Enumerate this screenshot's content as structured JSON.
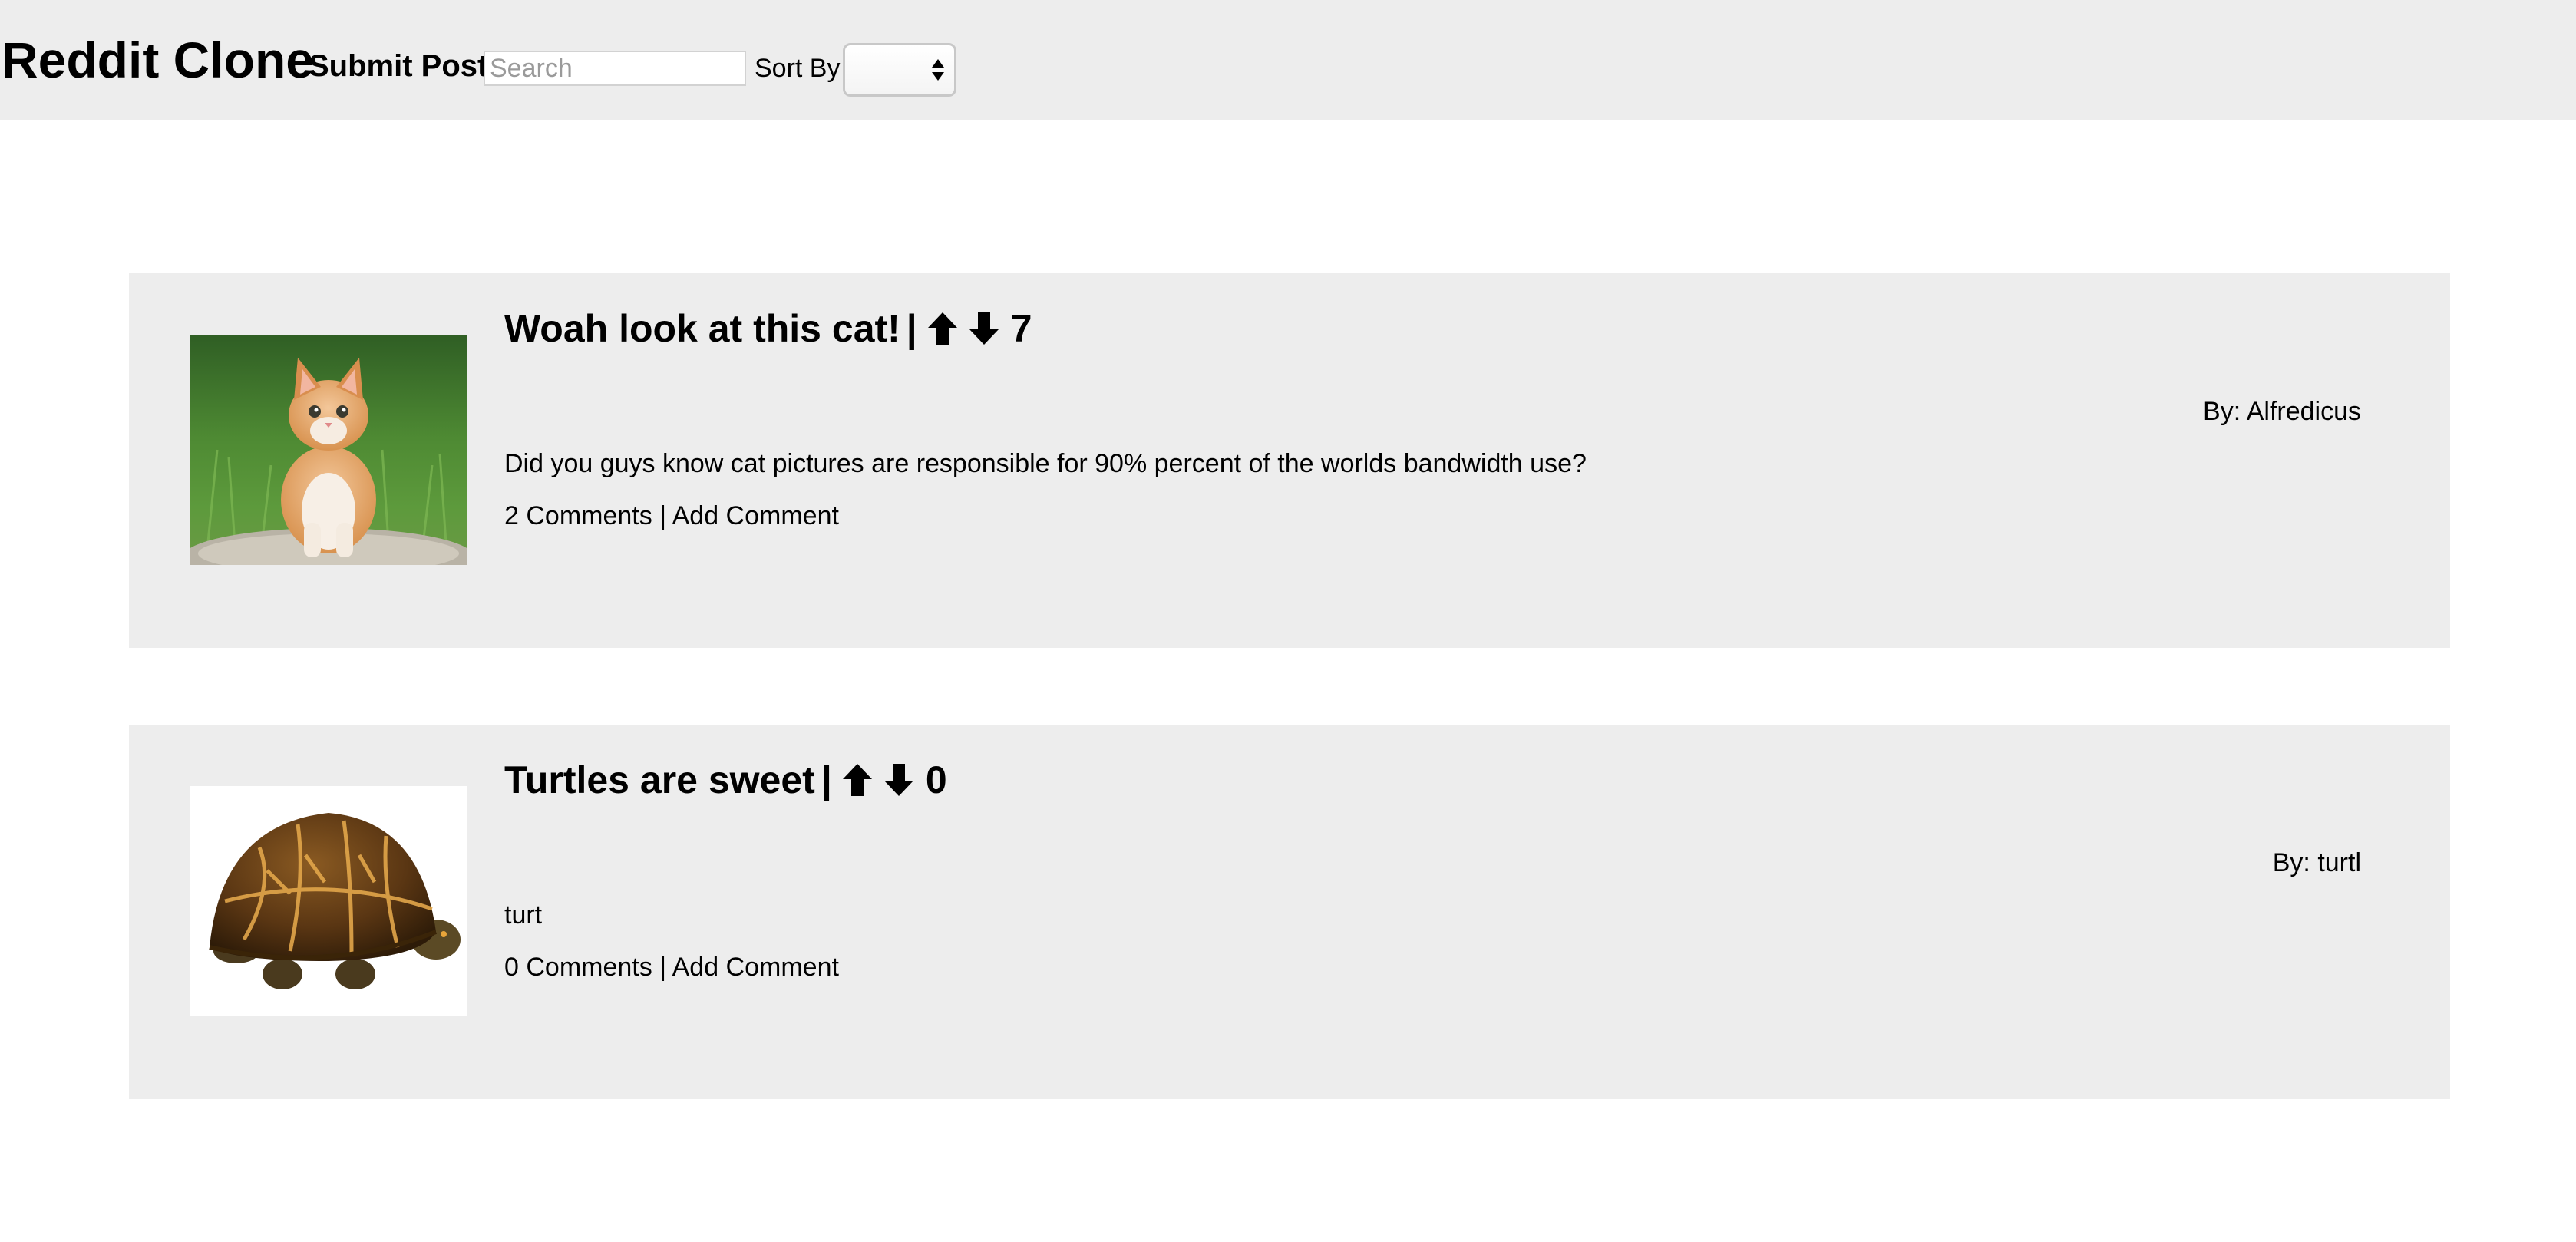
{
  "header": {
    "title": "Reddit Clone",
    "submit_label": "Submit Post",
    "search_placeholder": "Search",
    "sort_label": "Sort By",
    "sort_value": ""
  },
  "posts": [
    {
      "title": "Woah look at this cat!",
      "separator": "|",
      "score": "7",
      "author": "By: Alfredicus",
      "body": "Did you guys know cat pictures are responsible for 90% percent of the worlds bandwidth use?",
      "comments": "2 Comments",
      "links_separator": "|",
      "add_comment": "Add Comment",
      "image": "kitten-photo"
    },
    {
      "title": "Turtles are sweet",
      "separator": "|",
      "score": "0",
      "author": "By: turtl",
      "body": "turt",
      "comments": "0 Comments",
      "links_separator": "|",
      "add_comment": "Add Comment",
      "image": "turtle-photo"
    }
  ],
  "colors": {
    "header_bg": "#ededed",
    "card_bg": "#ededed",
    "text": "#000000"
  }
}
